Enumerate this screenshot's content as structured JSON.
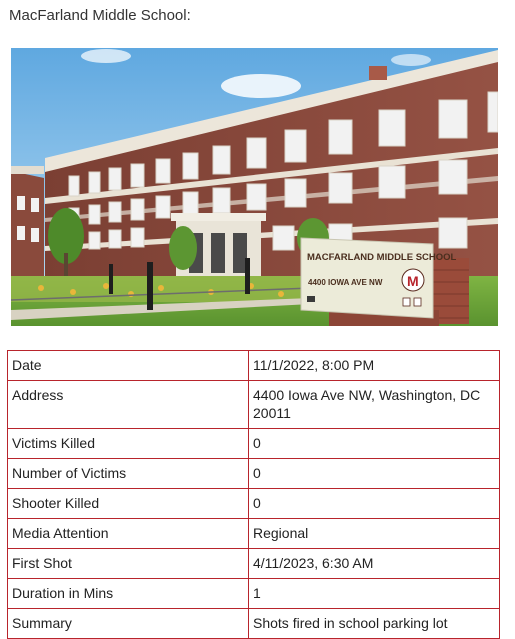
{
  "page": {
    "title": "MacFarland Middle School:"
  },
  "photo": {
    "sign_name": "MACFARLAND MIDDLE SCHOOL",
    "sign_address": "4400 IOWA AVE NW",
    "logo_letter": "M",
    "colors": {
      "sky": "#8cc3ea",
      "brick": "#8a4a3c",
      "trim": "#e9e4d8",
      "grass": "#6aa33a",
      "sign": "#ecebd9"
    }
  },
  "details": {
    "rows": [
      {
        "label": "Date",
        "value": "11/1/2022, 8:00 PM"
      },
      {
        "label": "Address",
        "value": "4400 Iowa Ave NW, Washington, DC 20011"
      },
      {
        "label": "Victims Killed",
        "value": "0"
      },
      {
        "label": "Number of Victims",
        "value": "0"
      },
      {
        "label": "Shooter Killed",
        "value": "0"
      },
      {
        "label": "Media Attention",
        "value": "Regional"
      },
      {
        "label": "First Shot",
        "value": "4/11/2023, 6:30 AM"
      },
      {
        "label": "Duration in Mins",
        "value": "1"
      },
      {
        "label": "Summary",
        "value": "Shots fired in school parking lot"
      }
    ]
  },
  "theme": {
    "table_border": "#b8242c"
  }
}
